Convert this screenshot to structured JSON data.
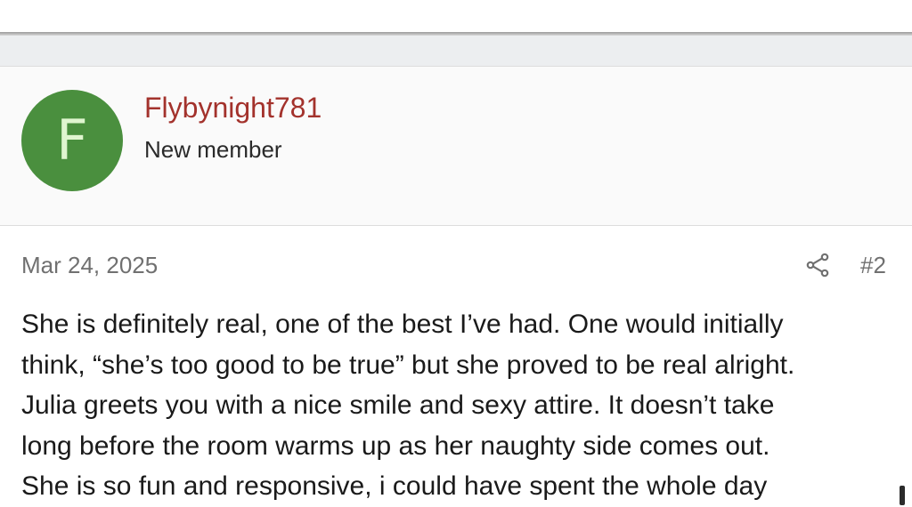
{
  "post": {
    "author": {
      "avatar_letter": "F",
      "avatar_color": "#4a8f3e",
      "username": "Flybynight781",
      "username_color": "#a3322c",
      "user_title": "New member"
    },
    "date": "Mar 24, 2025",
    "share_icon": "share-icon",
    "post_number": "#2",
    "body_lines": [
      "She is definitely real, one of the best I’ve had. One would initially",
      "think, “she’s too good to be true” but she proved to be real alright.",
      "Julia greets you with a nice smile and sexy attire. It doesn’t take",
      "long before the room warms up as her naughty side comes out.",
      "She is so fun and responsive, i could have spent the whole day"
    ]
  }
}
